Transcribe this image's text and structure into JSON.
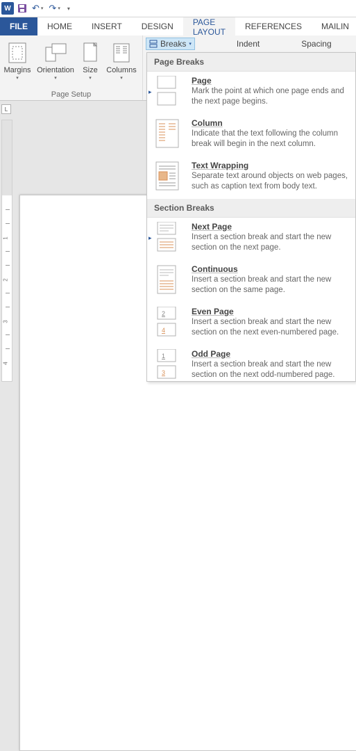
{
  "qat": {
    "word_glyph": "W"
  },
  "tabs": {
    "file": "FILE",
    "home": "HOME",
    "insert": "INSERT",
    "design": "DESIGN",
    "page_layout": "PAGE LAYOUT",
    "references": "REFERENCES",
    "mailings": "MAILIN"
  },
  "ribbon": {
    "breaks_label": "Breaks",
    "indent_label": "Indent",
    "spacing_label": "Spacing",
    "margins": "Margins",
    "orientation": "Orientation",
    "size": "Size",
    "columns": "Columns",
    "group_label": "Page Setup"
  },
  "ruler_corner": "L",
  "dropdown": {
    "page_breaks_header": "Page Breaks",
    "section_breaks_header": "Section Breaks",
    "items": {
      "page": {
        "title": "Page",
        "desc": "Mark the point at which one page ends and the next page begins."
      },
      "column": {
        "title": "Column",
        "desc": "Indicate that the text following the column break will begin in the next column."
      },
      "textwrap": {
        "title": "Text Wrapping",
        "desc": "Separate text around objects on web pages, such as caption text from body text."
      },
      "nextpage": {
        "title": "Next Page",
        "desc": "Insert a section break and start the new section on the next page."
      },
      "continuous": {
        "title": "Continuous",
        "desc": "Insert a section break and start the new section on the same page."
      },
      "evenpage": {
        "title": "Even Page",
        "desc": "Insert a section break and start the new section on the next even-numbered page."
      },
      "oddpage": {
        "title": "Odd Page",
        "desc": "Insert a section break and start the new section on the next odd-numbered page."
      }
    }
  }
}
